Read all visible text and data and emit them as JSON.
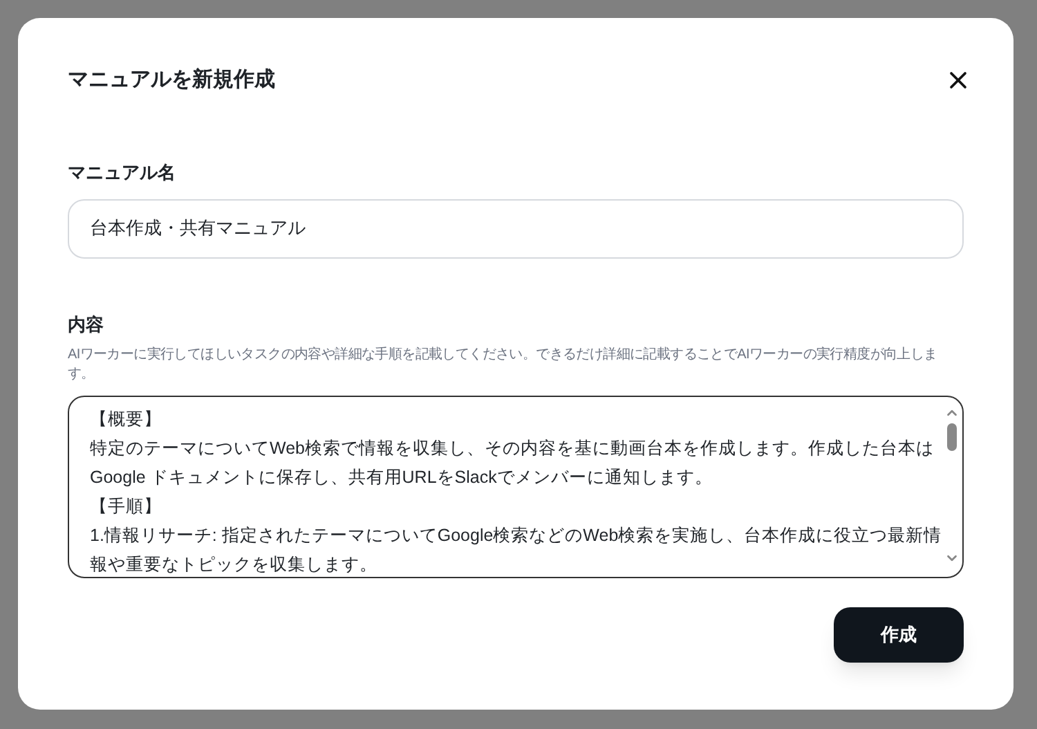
{
  "dialog": {
    "title": "マニュアルを新規作成",
    "name_field": {
      "label": "マニュアル名",
      "value": "台本作成・共有マニュアル"
    },
    "content_field": {
      "label": "内容",
      "help": "AIワーカーに実行してほしいタスクの内容や詳細な手順を記載してください。できるだけ詳細に記載することでAIワーカーの実行精度が向上します。",
      "lines": [
        "【概要】",
        "特定のテーマについてWeb検索で情報を収集し、その内容を基に動画台本を作成します。作成した台本はGoogle ドキュメントに保存し、共有用URLをSlackでメンバーに通知します。",
        "【手順】",
        "1.情報リサーチ: 指定されたテーマについてGoogle検索などのWeb検索を実施し、台本作成に役立つ最新情報や重要なトピックを収集します。"
      ]
    },
    "submit_button": "作成"
  }
}
